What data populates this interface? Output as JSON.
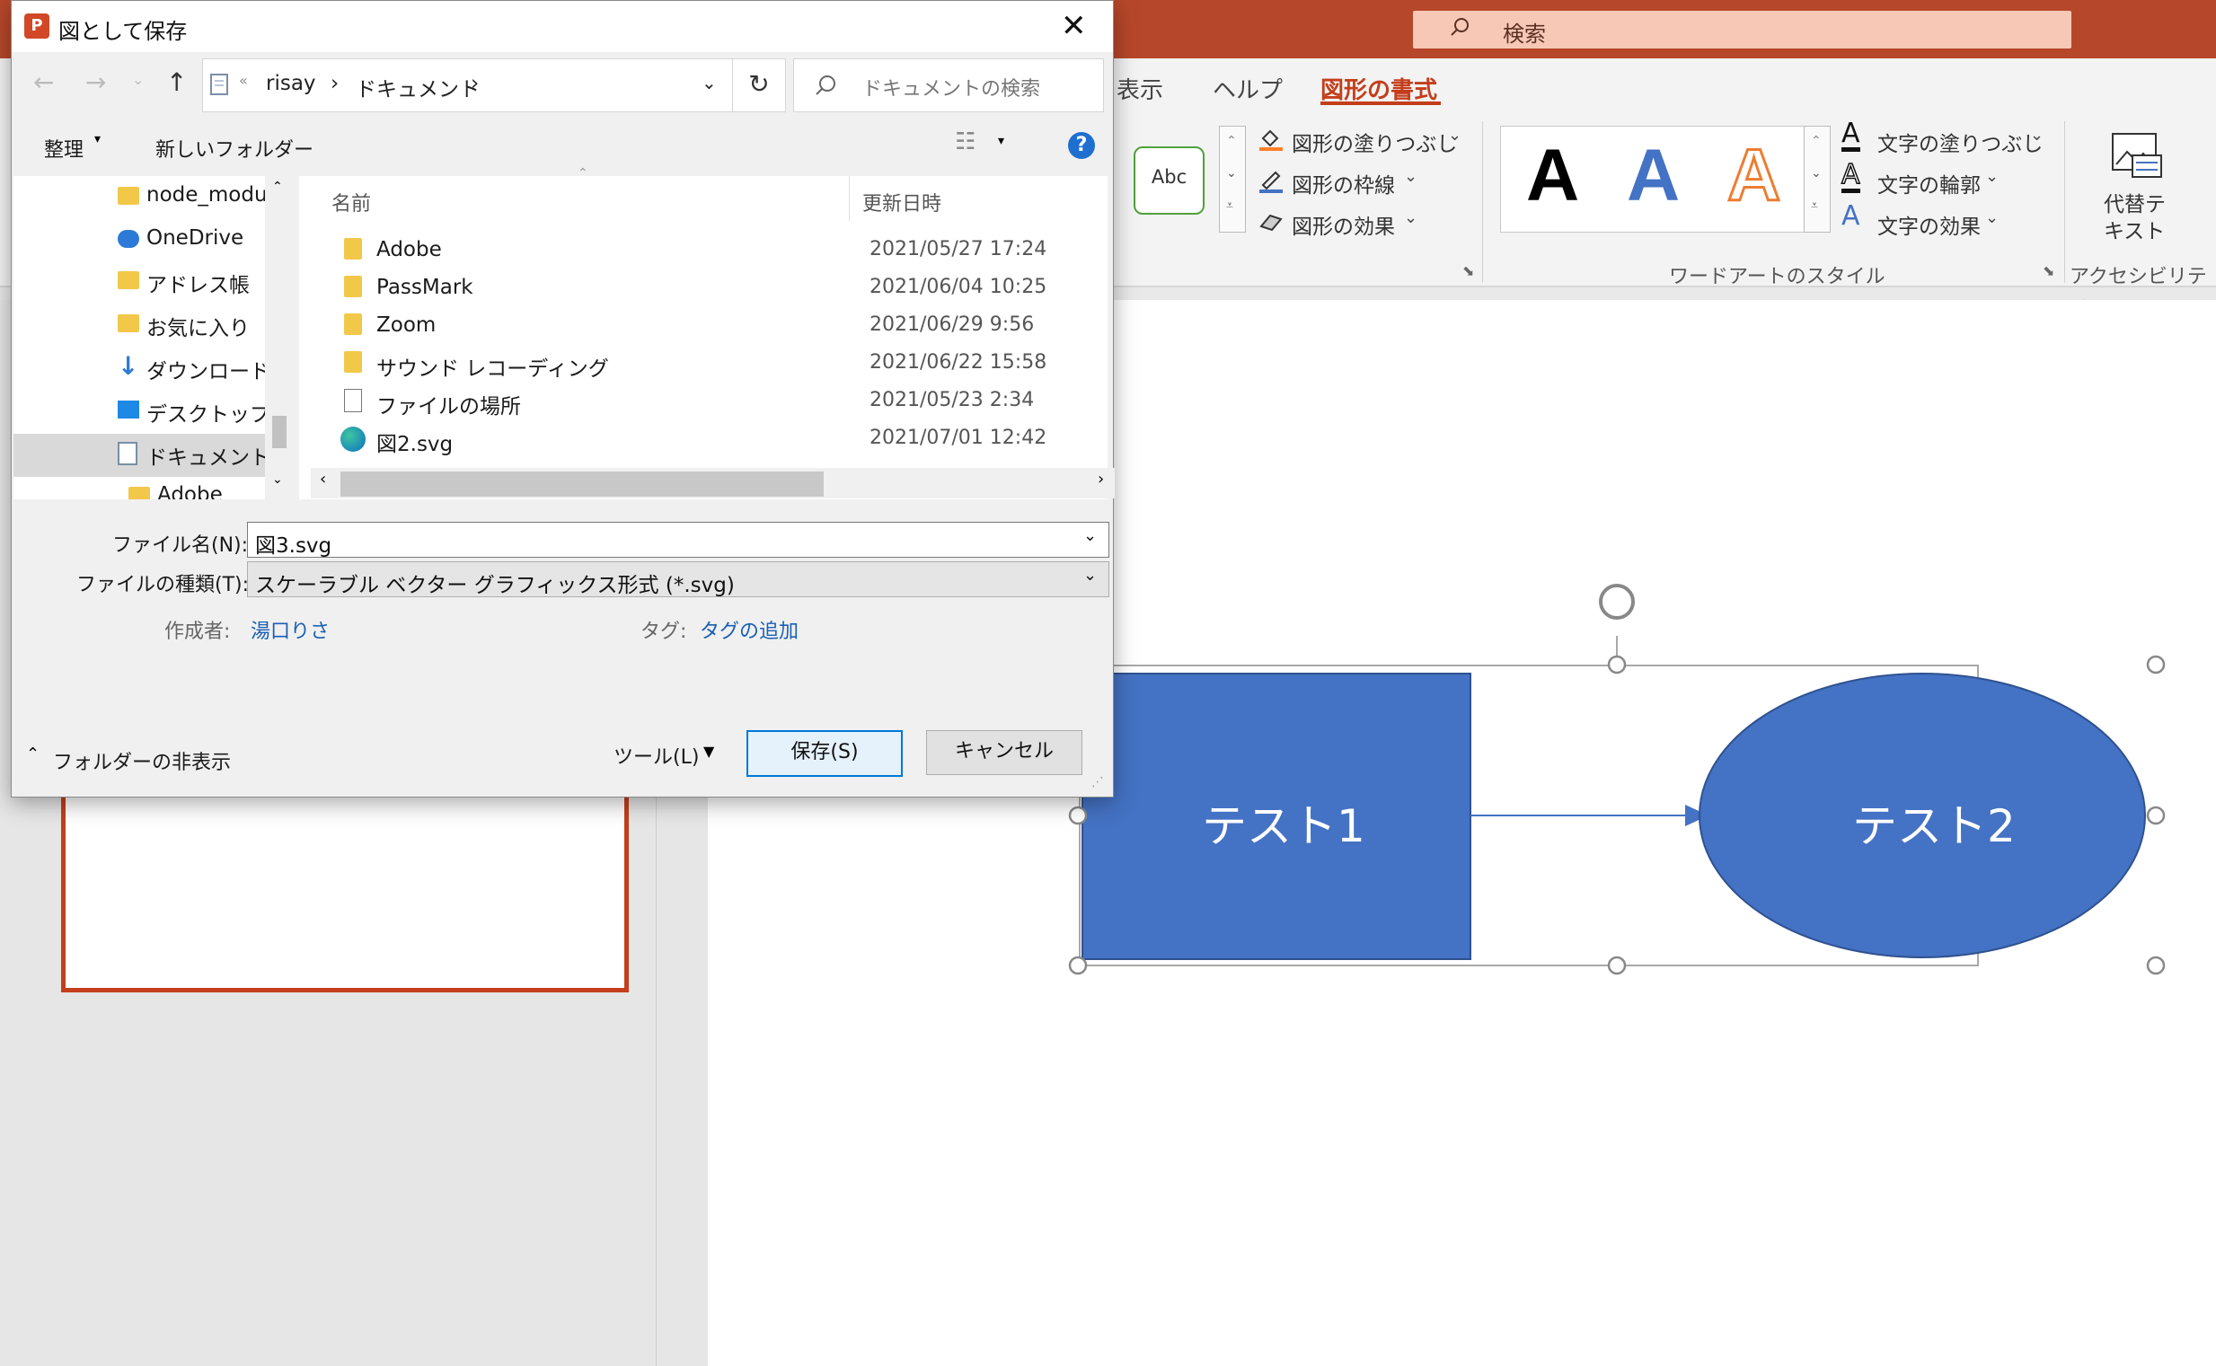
{
  "ppt": {
    "search_placeholder": "検索",
    "tabs": [
      {
        "label": "表示"
      },
      {
        "label": "ヘルプ"
      },
      {
        "label": "図形の書式"
      }
    ],
    "shape_styles": {
      "abc_label": "Abc",
      "fill": "図形の塗りつぶし",
      "outline": "図形の枠線",
      "effects": "図形の効果"
    },
    "wordart": {
      "letter": "A",
      "text_fill": "文字の塗りつぶし",
      "text_outline": "文字の輪郭",
      "text_effects": "文字の効果",
      "group_label": "ワードアートのスタイル"
    },
    "accessibility": {
      "alt_text_line1": "代替テ",
      "alt_text_line2": "キスト",
      "group_label": "アクセシビリティ"
    },
    "slide": {
      "shape1_text": "テスト1",
      "shape2_text": "テスト2"
    },
    "colors": {
      "brand": "#b7472a",
      "accent": "#c43e1c",
      "shape_fill": "#4472c4",
      "shape_stroke": "#2f528f"
    }
  },
  "dialog": {
    "title": "図として保存",
    "close_glyph": "✕",
    "address": {
      "overflow": "«",
      "crumbs": [
        {
          "label": "risay"
        },
        {
          "label": "ドキュメント"
        }
      ],
      "chevron": "›"
    },
    "search_placeholder": "ドキュメントの検索",
    "toolbar": {
      "organize": "整理",
      "new_folder": "新しいフォルダー"
    },
    "nav_items": [
      {
        "label": "node_modu",
        "icon": "folder-icon"
      },
      {
        "label": "OneDrive",
        "icon": "onedrive-icon"
      },
      {
        "label": "アドレス帳",
        "icon": "contacts-icon"
      },
      {
        "label": "お気に入り",
        "icon": "favorites-icon"
      },
      {
        "label": "ダウンロード",
        "icon": "download-icon"
      },
      {
        "label": "デスクトップ",
        "icon": "desktop-icon"
      },
      {
        "label": "ドキュメント",
        "icon": "documents-icon"
      },
      {
        "label": "Adobe",
        "icon": "folder-icon"
      }
    ],
    "columns": {
      "name": "名前",
      "date": "更新日時"
    },
    "files": [
      {
        "name": "Adobe",
        "date": "2021/05/27 17:24",
        "icon": "folder-icon"
      },
      {
        "name": "PassMark",
        "date": "2021/06/04 10:25",
        "icon": "folder-icon"
      },
      {
        "name": "Zoom",
        "date": "2021/06/29 9:56",
        "icon": "folder-icon"
      },
      {
        "name": "サウンド レコーディング",
        "date": "2021/06/22 15:58",
        "icon": "folder-icon"
      },
      {
        "name": "ファイルの場所",
        "date": "2021/05/23 2:34",
        "icon": "file-icon"
      },
      {
        "name": "図2.svg",
        "date": "2021/07/01 12:42",
        "icon": "edge-icon"
      }
    ],
    "filename_label": "ファイル名(N):",
    "filename_value": "図3.svg",
    "filetype_label": "ファイルの種類(T):",
    "filetype_value": "スケーラブル ベクター グラフィックス形式 (*.svg)",
    "author_label": "作成者:",
    "author_value": "湯口りさ",
    "tags_label": "タグ:",
    "tags_value": "タグの追加",
    "hide_folders": "フォルダーの非表示",
    "tools": "ツール(L)",
    "save": "保存(S)",
    "cancel": "キャンセル"
  }
}
